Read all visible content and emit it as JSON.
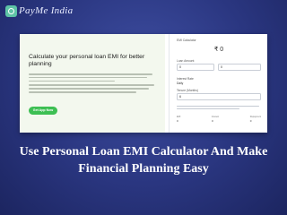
{
  "brand": {
    "logo_text": "PayMe India",
    "accent": "#5ec4a6"
  },
  "promo": {
    "title": "Calculate your personal loan EMI for better planning",
    "cta_label": "Get App Now",
    "cta_color": "#3dbf53"
  },
  "calculator": {
    "emi_label": "EMI Calculator",
    "emi_value": "₹ 0",
    "amount_label": "Loan Amount",
    "amount_value": "0",
    "rate_value": "0",
    "interest_label": "Interest Rate",
    "interest_value": "Daily",
    "tenure_label": "Tenure (Months)",
    "tenure_value": "6",
    "summary": [
      {
        "label": "EMI",
        "value": "0"
      },
      {
        "label": "Interest",
        "value": "0"
      },
      {
        "label": "Repayment",
        "value": "0"
      }
    ]
  },
  "headline": "Use Personal Loan EMI Calculator And Make Financial Planning Easy"
}
